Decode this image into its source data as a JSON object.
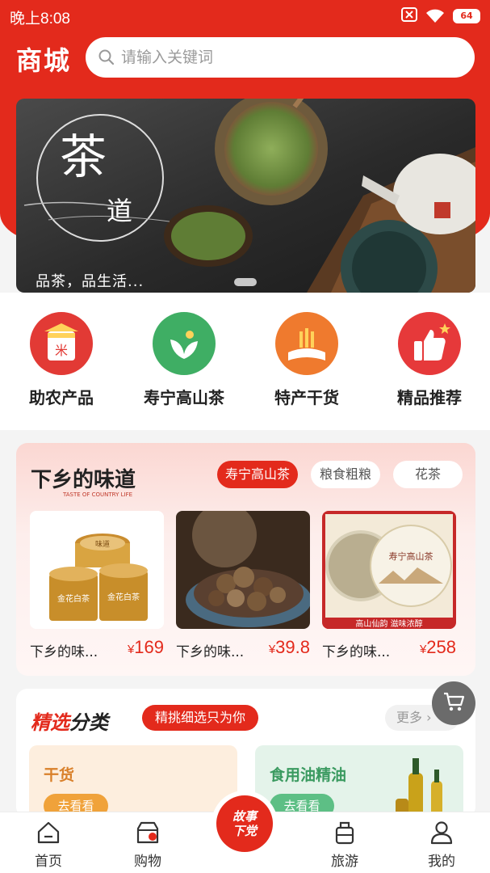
{
  "status": {
    "time": "晚上8:08",
    "battery": "64"
  },
  "header": {
    "title": "商城",
    "search_placeholder": "请输入关键词"
  },
  "banner": {
    "logo_char1": "茶",
    "logo_char2": "道",
    "caption": "品茶，品生活..."
  },
  "categories": [
    {
      "label": "助农产品",
      "icon": "rice-bag-icon",
      "color": "#e23a35"
    },
    {
      "label": "寿宁高山茶",
      "icon": "tea-leaf-icon",
      "color": "#3fae64"
    },
    {
      "label": "特产干货",
      "icon": "wheat-icon",
      "color": "#ef7a2e"
    },
    {
      "label": "精品推荐",
      "icon": "thumbs-up-icon",
      "color": "#e6393a"
    }
  ],
  "featured": {
    "logo_text": "下乡的味道",
    "logo_sub": "TASTE OF COUNTRY LIFE",
    "tabs": [
      "寿宁高山茶",
      "粮食粗粮",
      "花茶"
    ],
    "active_tab": 0,
    "products": [
      {
        "name": "下乡的味...",
        "currency": "¥",
        "price": "169",
        "image": "white-tea-tins",
        "img_texts": [
          "味道",
          "金花白茶",
          "金花白茶"
        ]
      },
      {
        "name": "下乡的味...",
        "currency": "¥",
        "price": "39.8",
        "image": "dried-mushrooms"
      },
      {
        "name": "下乡的味...",
        "currency": "¥",
        "price": "258",
        "image": "tea-cake",
        "img_texts": [
          "寿宁高山茶",
          "高山仙韵 滋味浓醇"
        ]
      }
    ]
  },
  "selection": {
    "title_a": "精选",
    "title_b": "分类",
    "badge": "精挑细选只为你",
    "more": "更多",
    "items": [
      {
        "label": "干货",
        "button": "去看看"
      },
      {
        "label": "食用油精油",
        "button": "去看看"
      }
    ]
  },
  "tabbar": {
    "items": [
      "首页",
      "购物",
      "旅游",
      "我的"
    ],
    "center": "故事下党"
  }
}
